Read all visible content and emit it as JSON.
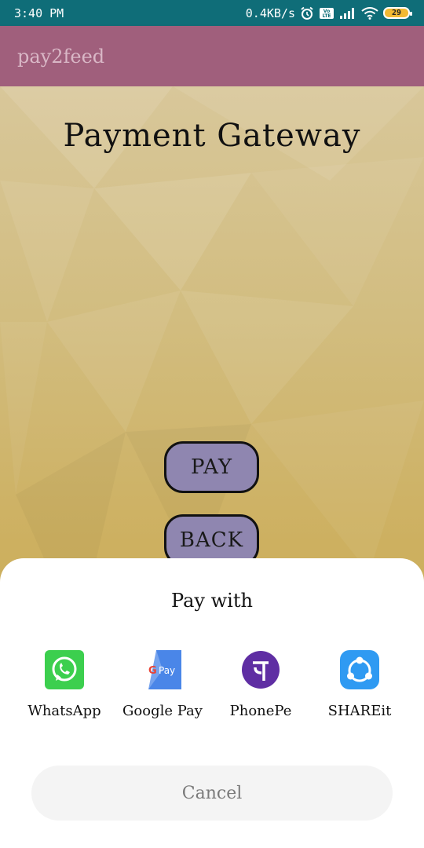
{
  "status_bar": {
    "time": "3:40 PM",
    "network_speed": "0.4KB/s",
    "battery": "29",
    "icons": [
      "alarm-icon",
      "volte-icon",
      "signal-icon",
      "wifi-icon",
      "battery-icon"
    ]
  },
  "app_bar": {
    "title": "pay2feed",
    "color": "#a05f7c"
  },
  "main": {
    "title": "Payment Gateway",
    "pay_button": "PAY",
    "back_button": "BACK"
  },
  "sheet": {
    "title": "Pay with",
    "apps": [
      {
        "label": "WhatsApp",
        "icon": "whatsapp-icon"
      },
      {
        "label": "Google Pay",
        "icon": "google-pay-icon"
      },
      {
        "label": "PhonePe",
        "icon": "phonepe-icon"
      },
      {
        "label": "SHAREit",
        "icon": "shareit-icon"
      }
    ],
    "cancel": "Cancel"
  },
  "colors": {
    "status_bar": "#0f6d78",
    "button_fill": "#8f86b0",
    "background": "#c9a94e"
  }
}
